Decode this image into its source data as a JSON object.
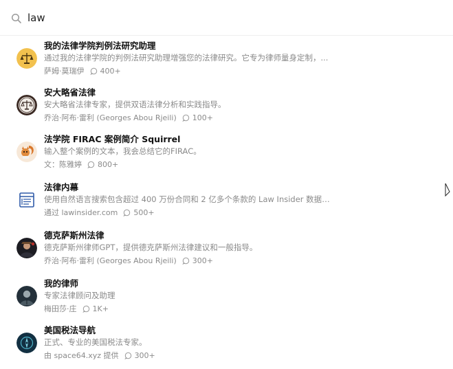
{
  "search": {
    "query": "law",
    "icon": "search-icon"
  },
  "results": [
    {
      "title": "我的法律学院判例法研究助理",
      "description": "通过我的法律学院的判例法研究助理增强您的法律研究。它专为律师量身定制，...",
      "author": "萨姆·莫瑞伊",
      "count": "400+",
      "avatar": "scales-gold-avatar"
    },
    {
      "title": "安大略省法律",
      "description": "安大略省法律专家，提供双语法律分析和实践指导。",
      "author": "乔治·阿布·雷利 (Georges Abou Rjeili)",
      "count": "100+",
      "avatar": "scales-seal-avatar"
    },
    {
      "title": "法学院 FIRAC 案例简介 Squirrel",
      "description": "输入整个案例的文本，我会总结它的FIRAC。",
      "author": "文：陈雅婷",
      "count": "800+",
      "avatar": "squirrel-avatar"
    },
    {
      "title": "法律内幕",
      "description": "使用自然语言搜索包含超过 400 万份合同和 2 亿多个条款的 Law Insider 数据库。",
      "author": "通过 lawinsider.com",
      "count": "500+",
      "avatar": "document-avatar"
    },
    {
      "title": "德克萨斯州法律",
      "description": "德克萨斯州律师GPT，提供德克萨斯州法律建议和一般指导。",
      "author": "乔治·阿布·雷利 (Georges Abou Rjeili)",
      "count": "300+",
      "avatar": "texas-lawyer-avatar"
    },
    {
      "title": "我的律师",
      "description": "专家法律顾问及助理",
      "author": "梅田莎·庄",
      "count": "1K+",
      "avatar": "lawyer-portrait-avatar"
    },
    {
      "title": "美国税法导航",
      "description": "正式、专业的美国税法专家。",
      "author": "由 space64.xyz 提供",
      "count": "300+",
      "avatar": "tax-navigator-avatar"
    }
  ]
}
